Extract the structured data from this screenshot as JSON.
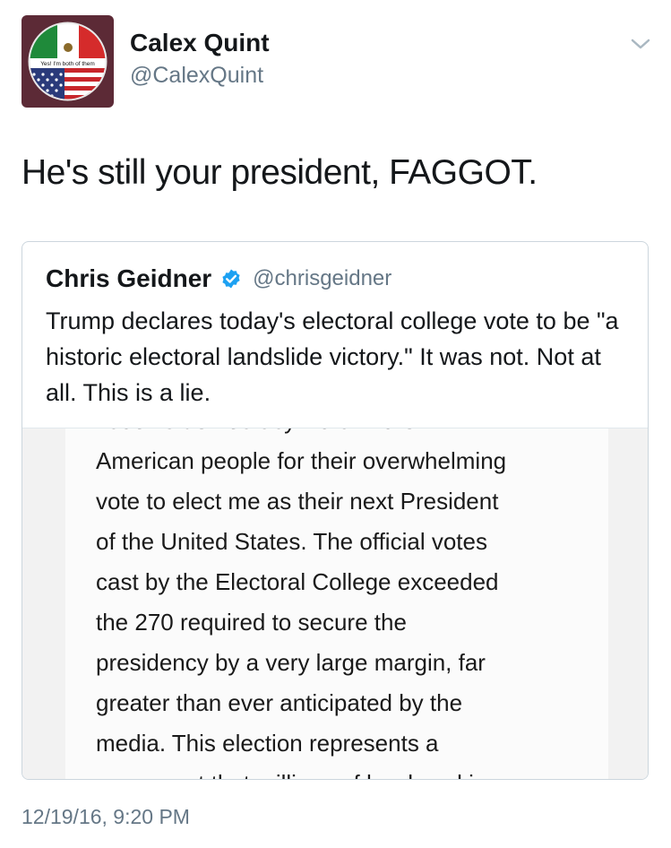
{
  "author": {
    "name": "Calex Quint",
    "handle": "@CalexQuint",
    "avatar_caption": "Yes! I'm both of them"
  },
  "tweet": {
    "text": "He's still your president, FAGGOT.",
    "timestamp": "12/19/16, 9:20 PM"
  },
  "quoted": {
    "name": "Chris Geidner",
    "handle": "@chrisgeidner",
    "verified": true,
    "text": "Trump declares today's electoral college vote to be \"a historic electoral landslide victory.\" It was not. Not at all. This is a lie.",
    "media_lines": [
      "nation's democracy. I thank the",
      "American people for their overwhelming",
      "vote to elect me as their next President",
      "of the United States. The official votes",
      "cast by the Electoral College exceeded",
      "the 270 required to secure the",
      "presidency by a very large margin, far",
      "greater than ever anticipated by the",
      "media. This election represents a",
      "movement that millions of hard working"
    ]
  },
  "colors": {
    "secondary_text": "#657786",
    "verified_blue": "#1da1f2",
    "border": "#ccd6dd"
  },
  "icons": {
    "menu": "chevron-down-icon",
    "verified": "verified-badge-icon"
  }
}
